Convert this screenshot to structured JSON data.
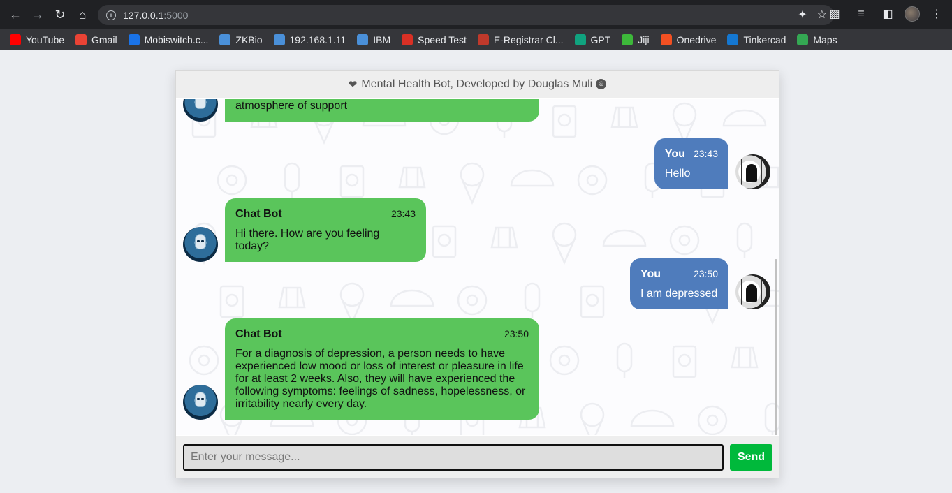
{
  "browser": {
    "url_host": "127.0.0.1",
    "url_port": ":5000",
    "bookmarks": [
      {
        "label": "YouTube",
        "icon": "youtube-icon",
        "color": "#ff0000"
      },
      {
        "label": "Gmail",
        "icon": "gmail-icon",
        "color": "#ea4335"
      },
      {
        "label": "Mobiswitch.c...",
        "icon": "mobiswitch-icon",
        "color": "#1a73e8"
      },
      {
        "label": "ZKBio",
        "icon": "shield-icon",
        "color": "#4a90d9"
      },
      {
        "label": "192.168.1.11",
        "icon": "grid-icon",
        "color": "#4a90d9"
      },
      {
        "label": "IBM",
        "icon": "grid-icon",
        "color": "#4a90d9"
      },
      {
        "label": "Speed Test",
        "icon": "speedometer-icon",
        "color": "#d93025"
      },
      {
        "label": "E-Registrar Cl...",
        "icon": "eregistrar-icon",
        "color": "#c0392b"
      },
      {
        "label": "GPT",
        "icon": "openai-icon",
        "color": "#10a37f"
      },
      {
        "label": "Jiji",
        "icon": "jiji-icon",
        "color": "#3db83a"
      },
      {
        "label": "Onedrive",
        "icon": "microsoft-icon",
        "color": "#f25022"
      },
      {
        "label": "Tinkercad",
        "icon": "tinkercad-icon",
        "color": "#1477d1"
      },
      {
        "label": "Maps",
        "icon": "maps-icon",
        "color": "#34a853"
      }
    ]
  },
  "chat": {
    "title": "Mental Health Bot, Developed by Douglas Muli",
    "messages": [
      {
        "sender": "bot",
        "name": "",
        "time": "",
        "text": "dedicated to safeguarding your well-being and creating an atmosphere of support"
      },
      {
        "sender": "user",
        "name": "You",
        "time": "23:43",
        "text": "Hello"
      },
      {
        "sender": "bot",
        "name": "Chat Bot",
        "time": "23:43",
        "text": "Hi there. How are you feeling today?"
      },
      {
        "sender": "user",
        "name": "You",
        "time": "23:50",
        "text": "I am depressed"
      },
      {
        "sender": "bot",
        "name": "Chat Bot",
        "time": "23:50",
        "text": "For a diagnosis of depression, a person needs to have experienced low mood or loss of interest or pleasure in life for at least 2 weeks. Also, they will have experienced the following symptoms: feelings of sadness, hopelessness, or irritability nearly every day."
      }
    ],
    "input_placeholder": "Enter your message...",
    "send_label": "Send"
  },
  "colors": {
    "bot_bubble": "#5ac55b",
    "user_bubble": "#4f7cbc",
    "send_button": "#00b93b"
  }
}
